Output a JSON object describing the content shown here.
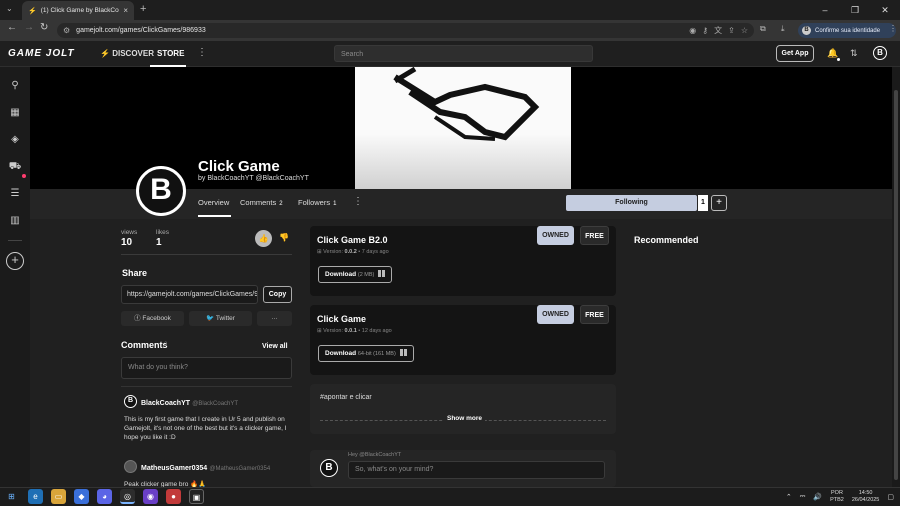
{
  "browser": {
    "tab_title": "(1) Click Game by BlackCoachYT",
    "url": "gamejolt.com/games/ClickGames/986933",
    "identity_label": "Confirme sua identidade",
    "identity_initial": "B"
  },
  "gj": {
    "logo": "GAME JOLT",
    "nav": {
      "discover": "DISCOVER",
      "store": "STORE"
    },
    "search_placeholder": "Search",
    "get_app": "Get App",
    "avatar": "B"
  },
  "game": {
    "title": "Click Game",
    "byline": "by BlackCoachYT @BlackCoachYT",
    "avatar": "B",
    "tabs": [
      {
        "label": "Overview"
      },
      {
        "label": "Comments",
        "badge": "2"
      },
      {
        "label": "Followers",
        "badge": "1"
      }
    ],
    "follow": {
      "label": "Following",
      "count": "1",
      "plus": "+"
    }
  },
  "stats": {
    "views_label": "views",
    "views": "10",
    "likes_label": "likes",
    "likes": "1"
  },
  "share": {
    "title": "Share",
    "url": "https://gamejolt.com/games/ClickGames/986933",
    "copy": "Copy",
    "facebook": "Facebook",
    "twitter": "Twitter",
    "more": "···"
  },
  "comments": {
    "title": "Comments",
    "count": "2",
    "view_all": "View all",
    "placeholder": "What do you think?",
    "items": [
      {
        "name": "BlackCoachYT",
        "handle": "@BlackCoachYT",
        "avatar": "B",
        "text": "This is my first game that I create in Ur 5 and publish on Gamejolt, it's not one of the best but it's a clicker game, I hope you like it :D"
      },
      {
        "name": "MatheusGamer0354",
        "handle": "@MatheusGamer0354",
        "avatar": "",
        "text": "Peak clicker game bro 🔥🙏"
      }
    ]
  },
  "builds": [
    {
      "title": "Click Game B2.0",
      "version_label": "Version:",
      "version": "0.0.2",
      "age": "7 days ago",
      "download": "Download",
      "size": "(2 MB)",
      "owned": "OWNED",
      "free": "FREE"
    },
    {
      "title": "Click Game",
      "version_label": "Version:",
      "version": "0.0.1",
      "age": "12 days ago",
      "download": "Download",
      "size": "64-bit (161 MB)",
      "owned": "OWNED",
      "free": "FREE"
    }
  ],
  "description": {
    "tag": "#apontar e clicar",
    "show_more": "Show more"
  },
  "post": {
    "hint": "Hey @BlackCoachYT",
    "placeholder": "So, what's on your mind?",
    "avatar": "B"
  },
  "recommended": "Recommended",
  "tray": {
    "lang1": "POR",
    "lang2": "PTB2",
    "time": "14:50",
    "date": "26/04/2025"
  },
  "colors": {
    "accent": "#c5cde0",
    "background": "#202020",
    "panel": "#141414"
  }
}
